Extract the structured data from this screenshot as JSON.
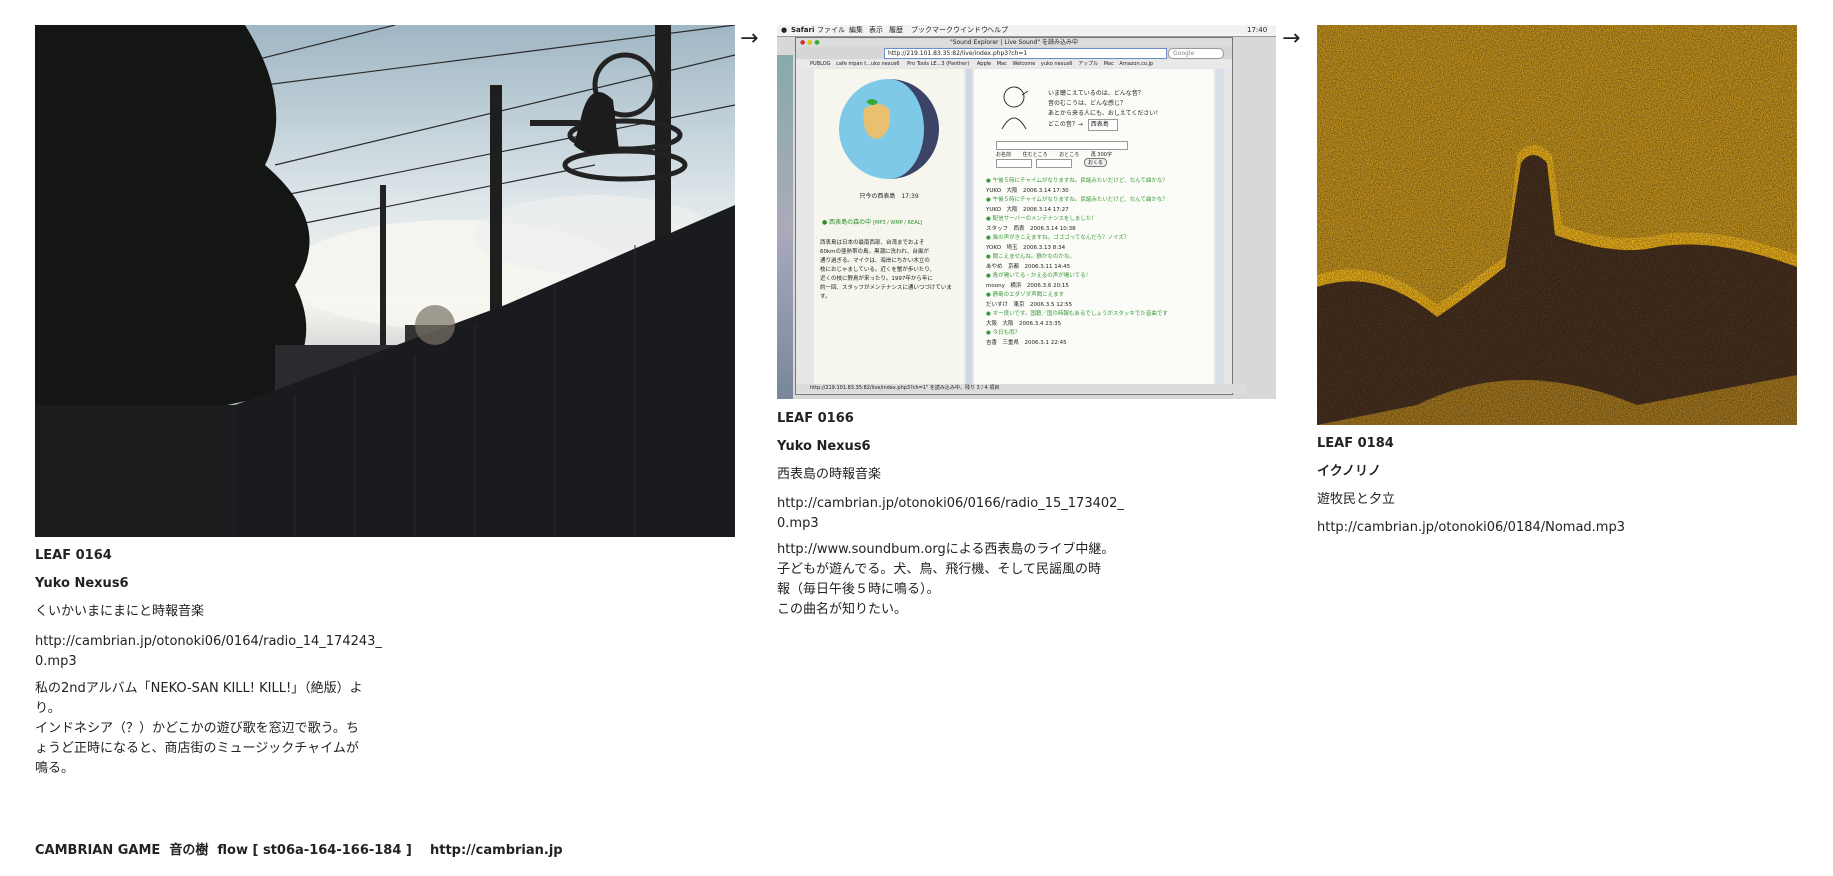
{
  "arrows": [
    "→",
    "→"
  ],
  "leaves": [
    {
      "id_label": "LEAF 0164",
      "artist": "Yuko Nexus6",
      "title": "くいかいまにまにと時報音楽",
      "url_lines": [
        "http://cambrian.jp/otonoki06/0164/radio_14_174243_",
        "0.mp3"
      ],
      "desc_lines": [
        "私の2ndアルバム「NEKO-SAN KILL! KILL!」（絶版）よ",
        "り。",
        "インドネシア（？）かどこかの遊び歌を窓辺で歌う。ち",
        "ょうど正時になると、商店街のミュージックチャイムが",
        "鳴る。"
      ]
    },
    {
      "id_label": "LEAF 0166",
      "artist": "Yuko Nexus6",
      "title": "西表島の時報音楽",
      "url_lines": [
        "http://cambrian.jp/otonoki06/0166/radio_15_173402_",
        "0.mp3"
      ],
      "desc_lines": [
        "http://www.soundbum.orgによる西表島のライブ中継。",
        "子どもが遊んでる。犬、鳥、飛行機、そして民謡風の時",
        "報（毎日午後５時に鳴る）。",
        "この曲名が知りたい。"
      ]
    },
    {
      "id_label": "LEAF 0184",
      "artist": "イクノリノ",
      "title": "遊牧民と夕立",
      "url_lines": [
        "http://cambrian.jp/otonoki06/0184/Nomad.mp3"
      ]
    }
  ],
  "screenshot": {
    "menubar": [
      "Safari",
      "ファイル",
      "編集",
      "表示",
      "履歴",
      "ブックマーク",
      "ウインドウ",
      "ヘルプ"
    ],
    "clock": "17:40",
    "window_title": "\"Sound Explorer | Live Sound\" を読み込み中",
    "address": "http://219.101.83.35:82/live/index.php3?ch=1",
    "search_placeholder": "Google",
    "bookmarks": [
      "PUBLOG",
      "cafe mpan t...uko nexus6",
      "Pro Tools LE...3 (Panther)",
      "Apple",
      "Mac",
      "Welcome",
      "yuko nexus6",
      "アップル",
      "Mac",
      "Amazon.co.jp"
    ],
    "globe_caption": "只今の西表島　17:39",
    "stream_link": "西表島の森の中",
    "stream_formats": "[MP3 / WMP / REAL]",
    "left_text": [
      "西表島は日本の最南西部、台湾までおよそ",
      "60kmの亜熱帯の島。黒潮に洗われ、台風が",
      "通り過ぎる。マイクは、海岸にちかい木立の",
      "枝におじゃましている。近くを蟹が歩いたり、",
      "近くの枝に野鳥が来ったり。1997年から年に",
      "約一回、スタッフがメンテナンスに通いつづけています。"
    ],
    "question_lines": [
      "いま聴こえているのは、どんな音？",
      "音のむこうは、どんな感じ？",
      "あとから来る人にも、おしえてください！",
      "どこの音？→"
    ],
    "select_value": "西表島",
    "form_labels": [
      "お名前",
      "住むところ",
      "おところ",
      "再 300字"
    ],
    "send_label": "おくる",
    "posts": [
      {
        "msg": "午後５時にチャイムがなりますね。民謡みたいだけど、なんて曲かな？",
        "meta": "YUKO　大阪　2006.3.14 17:30"
      },
      {
        "msg": "午後５時にチャイムがなりますね。民謡みたいだけど、なんて曲かな？",
        "meta": "YUKO　大阪　2006.3.14 17:27"
      },
      {
        "msg": "配信サーバーのメンテナンスをしました！",
        "meta": "スタッフ　西表　2006.3.14 10:38"
      },
      {
        "msg": "風の声がきこえますね。ゴゴゴってなんだろ？ノイズ？",
        "meta": "YOKO　埼玉　2006.3.13 8:34"
      },
      {
        "msg": "聞こえませんね。静かなのかな。",
        "meta": "あやめ　京都　2006.3.11 14:45"
      },
      {
        "msg": "鳥が鳴いてる・かえるの声が鳴いてる！",
        "meta": "moony　横浜　2006.3.6 20:15"
      },
      {
        "msg": "静島のエダゾダ声聞こえます",
        "meta": "だいすけ　東京　2006.3.5 12:55"
      },
      {
        "msg": "オー良いです。国籍／国の時報もあるでしょうがスタッキでた音曲です",
        "meta": "大阪　大阪　2006.3.4 23:35"
      },
      {
        "msg": "今日も雨？",
        "meta": "吉香　三重県　2006.3.1 22:45"
      }
    ],
    "status_text": "http://219.101.83.35:82/live/index.php3?ch=1\" を読み込み中、残り 3 / 4 項目"
  },
  "footer": {
    "left": "CAMBRIAN GAME  音の樹  flow [ st06a-164-166-184 ]",
    "url": "http://cambrian.jp"
  }
}
